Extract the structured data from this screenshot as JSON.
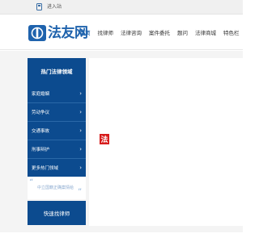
{
  "topbar": {
    "login_label": "进入站"
  },
  "header": {
    "logo_text": "法友网"
  },
  "nav": {
    "items": [
      {
        "label": "首页"
      },
      {
        "label": "找律师"
      },
      {
        "label": "法律咨询"
      },
      {
        "label": "案件委托"
      },
      {
        "label": "题问"
      },
      {
        "label": "法律商城"
      },
      {
        "label": "特色栏"
      }
    ]
  },
  "sidebar": {
    "title": "热门法律领域",
    "items": [
      {
        "label": "家庭婚姻"
      },
      {
        "label": "劳动争议"
      },
      {
        "label": "交通事故"
      },
      {
        "label": "刑事辩护"
      },
      {
        "label": "更多热门领域"
      }
    ],
    "quote_text": "中立国籍正确案情给",
    "quick_button_label": "快速找律师"
  },
  "content": {
    "badge_text": "法"
  },
  "colors": {
    "brand_blue": "#0c4b8f",
    "logo_blue": "#1f63ad",
    "badge_red": "#d71d1d"
  }
}
